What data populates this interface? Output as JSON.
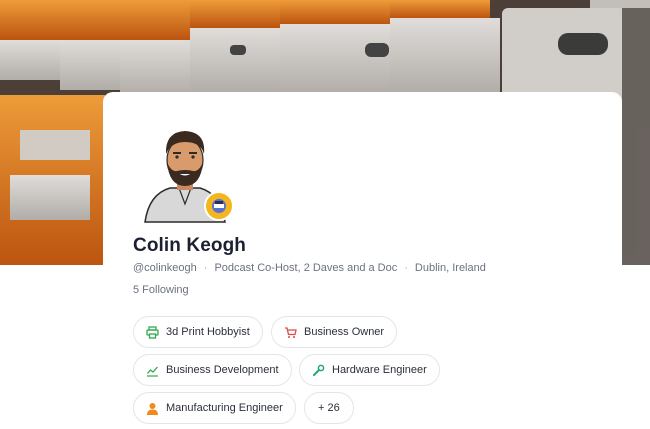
{
  "profile": {
    "name": "Colin Keogh",
    "handle": "@colinkeogh",
    "role": "Podcast Co-Host, 2 Daves and a Doc",
    "location": "Dublin, Ireland",
    "following": "5 Following",
    "separator": "·"
  },
  "tags": [
    {
      "label": "3d Print Hobbyist",
      "icon": "printer-icon",
      "color": "#2fa84f"
    },
    {
      "label": "Business Owner",
      "icon": "cart-icon",
      "color": "#e04848"
    },
    {
      "label": "Business Development",
      "icon": "trend-icon",
      "color": "#2fa84f"
    },
    {
      "label": "Hardware Engineer",
      "icon": "wrench-icon",
      "color": "#1ea97c"
    },
    {
      "label": "Manufacturing Engineer",
      "icon": "person-icon",
      "color": "#f08a1a"
    },
    {
      "label": "+ 26"
    }
  ],
  "colors": {
    "badge": "#f3b61f",
    "text_primary": "#1c2130",
    "text_secondary": "#6b7280",
    "chip_border": "#e3e5e9"
  }
}
